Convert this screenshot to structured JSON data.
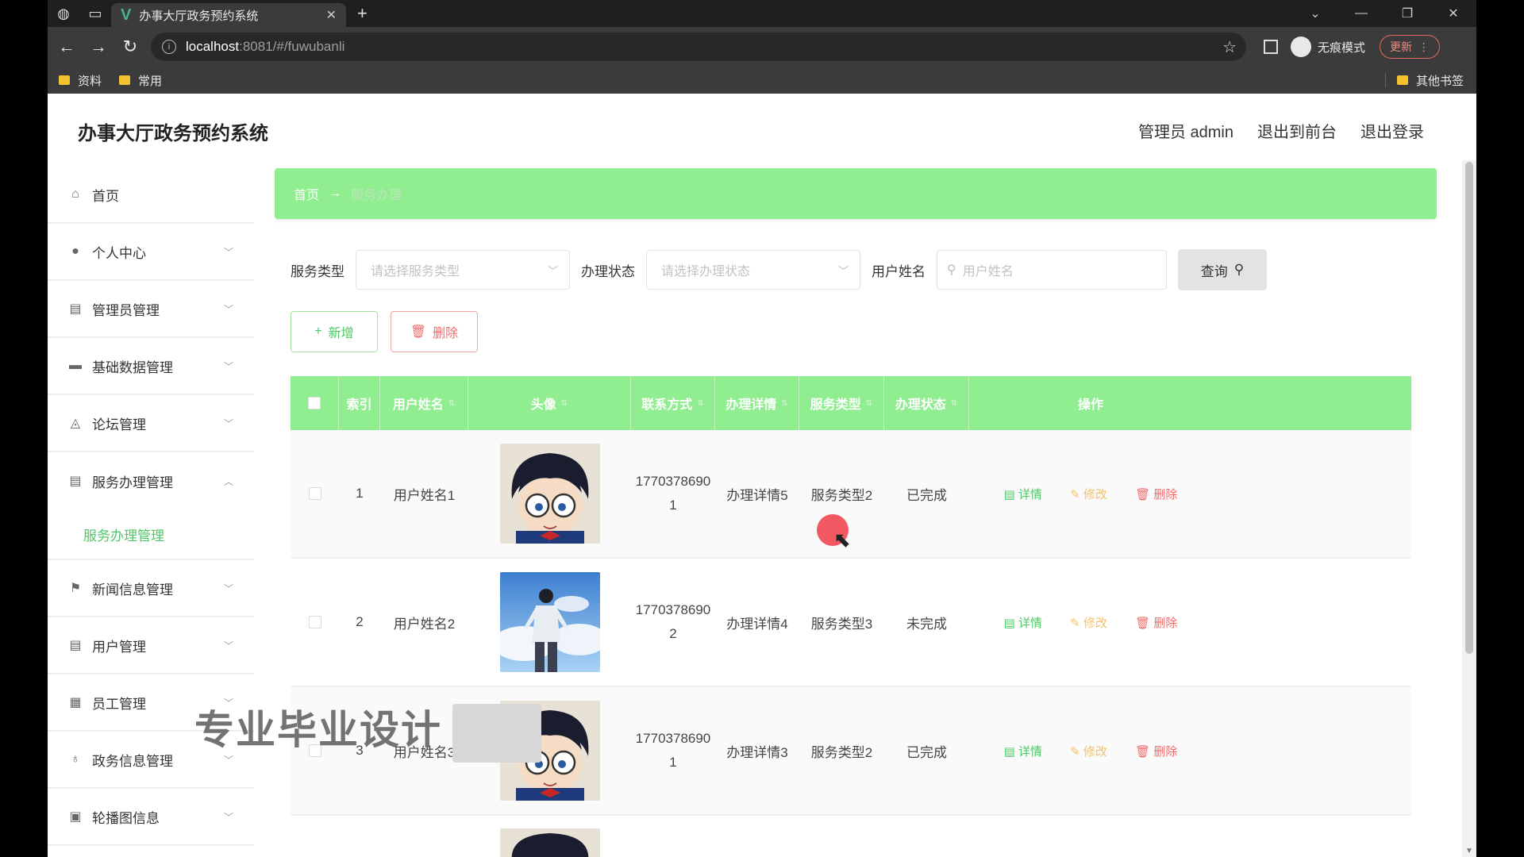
{
  "browser": {
    "tab_title": "办事大厅政务预约系统",
    "url_host": "localhost",
    "url_path": ":8081/#/fuwubanli",
    "incognito_label": "无痕模式",
    "update_label": "更新",
    "bookmarks": [
      "资料",
      "常用"
    ],
    "other_bookmarks": "其他书签"
  },
  "header": {
    "title": "办事大厅政务预约系统",
    "admin_label": "管理员 admin",
    "back_to_front": "退出到前台",
    "logout": "退出登录"
  },
  "sidebar": {
    "items": [
      {
        "label": "首页",
        "icon": "home-icon"
      },
      {
        "label": "个人中心",
        "icon": "user-icon"
      },
      {
        "label": "管理员管理",
        "icon": "clipboard-icon"
      },
      {
        "label": "基础数据管理",
        "icon": "monitor-icon"
      },
      {
        "label": "论坛管理",
        "icon": "bell-icon"
      },
      {
        "label": "服务办理管理",
        "icon": "clipboard-icon"
      },
      {
        "label": "新闻信息管理",
        "icon": "flag-icon"
      },
      {
        "label": "用户管理",
        "icon": "clipboard-icon"
      },
      {
        "label": "员工管理",
        "icon": "grid-icon"
      },
      {
        "label": "政务信息管理",
        "icon": "mic-icon"
      },
      {
        "label": "轮播图信息",
        "icon": "briefcase-icon"
      }
    ],
    "active_sub": "服务办理管理"
  },
  "breadcrumb": {
    "home": "首页",
    "current": "服务办理"
  },
  "search": {
    "service_type_label": "服务类型",
    "service_type_placeholder": "请选择服务类型",
    "status_label": "办理状态",
    "status_placeholder": "请选择办理状态",
    "username_label": "用户姓名",
    "username_placeholder": "用户姓名",
    "query_label": "查询"
  },
  "actions": {
    "add_label": "新增",
    "delete_label": "删除"
  },
  "table": {
    "headers": [
      "索引",
      "用户姓名",
      "头像",
      "联系方式",
      "办理详情",
      "服务类型",
      "办理状态",
      "操作"
    ],
    "rows": [
      {
        "index": "1",
        "name": "用户姓名1",
        "avatar": "conan",
        "phone1": "1770378690",
        "phone2": "1",
        "detail": "办理详情5",
        "type": "服务类型2",
        "status": "已完成"
      },
      {
        "index": "2",
        "name": "用户姓名2",
        "avatar": "sky",
        "phone1": "1770378690",
        "phone2": "2",
        "detail": "办理详情4",
        "type": "服务类型3",
        "status": "未完成"
      },
      {
        "index": "3",
        "name": "用户姓名3",
        "avatar": "conan",
        "phone1": "1770378690",
        "phone2": "1",
        "detail": "办理详情3",
        "type": "服务类型2",
        "status": "已完成"
      }
    ],
    "op_detail": "详情",
    "op_edit": "修改",
    "op_delete": "删除"
  },
  "watermark": "专业毕业设计"
}
